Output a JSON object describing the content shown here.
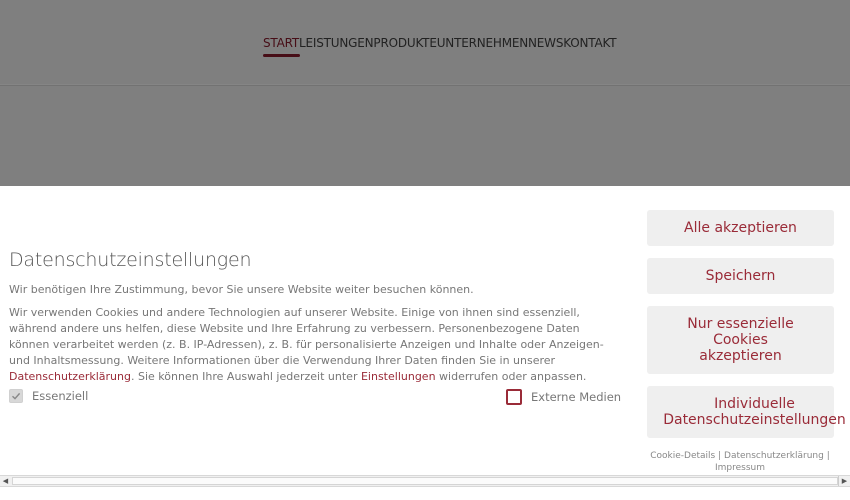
{
  "nav": {
    "items": [
      {
        "label": "START",
        "active": true
      },
      {
        "label": "LEISTUNGEN",
        "active": false
      },
      {
        "label": "PRODUKTE",
        "active": false
      },
      {
        "label": "UNTERNEHMEN",
        "active": false
      },
      {
        "label": "NEWS",
        "active": false
      },
      {
        "label": "KONTAKT",
        "active": false
      }
    ]
  },
  "consent": {
    "title": "Datenschutzeinstellungen",
    "intro": "Wir benötigen Ihre Zustimmung, bevor Sie unsere Website weiter besuchen können.",
    "body_part1": "Wir verwenden Cookies und andere Technologien auf unserer Website. Einige von ihnen sind essenziell, während andere uns helfen, diese Website und Ihre Erfahrung zu verbessern. Personenbezogene Daten können verarbeitet werden (z. B. IP-Adressen), z. B. für personalisierte Anzeigen und Inhalte oder Anzeigen- und Inhaltsmessung. Weitere Informationen über die Verwendung Ihrer Daten finden Sie in unserer ",
    "privacy_link": "Datenschutzerklärung",
    "body_part2": ". Sie können Ihre Auswahl jederzeit unter ",
    "settings_link": "Einstellungen",
    "body_part3": " widerrufen oder anpassen.",
    "checkboxes": {
      "essential": {
        "label": "Essenziell",
        "checked": true
      },
      "external": {
        "label": "Externe Medien",
        "checked": false
      }
    },
    "buttons": {
      "accept_all": "Alle akzeptieren",
      "save": "Speichern",
      "essential_only": [
        "Nur essenzielle",
        "Cookies",
        "akzeptieren"
      ],
      "individual": [
        "Individuelle",
        "Datenschutzeinstellungen"
      ]
    },
    "footer": {
      "cookie_details": "Cookie-Details",
      "separator": "|",
      "privacy": "Datenschutzerklärung",
      "imprint": "Impressum"
    }
  },
  "scrollbar": {
    "left_arrow": "◀",
    "right_arrow": "▶"
  },
  "colors": {
    "accent": "#9a2b38",
    "button_bg": "#efefef",
    "overlay": "rgba(0,0,0,0.5)"
  }
}
